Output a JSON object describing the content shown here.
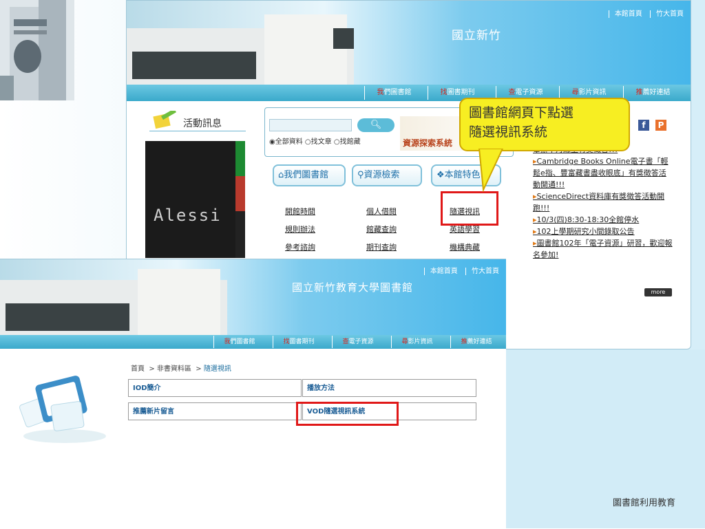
{
  "top_site": {
    "site_title": "國立新竹",
    "top_links": [
      "本館首頁",
      "竹大首頁"
    ],
    "nav": [
      {
        "accent": "我",
        "rest": "們圖書館"
      },
      {
        "accent": "找",
        "rest": "圖書期刊"
      },
      {
        "accent": "查",
        "rest": "電子資源"
      },
      {
        "accent": "尋",
        "rest": "影片資訊"
      },
      {
        "accent": "推",
        "rest": "薦好連結"
      }
    ],
    "activity_title": "活動訊息",
    "book_text": "Alessi",
    "search": {
      "button_icon": "search-icon",
      "radio_options": [
        "全部資料",
        "找文章",
        "找館藏"
      ],
      "selected": "全部資料",
      "resource_label": "資源探索系統"
    },
    "feature_buttons": [
      "我們圖書館",
      "資源檢索",
      "本館特色"
    ],
    "links": [
      [
        "開館時間",
        "個人借閱",
        "隨選視訊"
      ],
      [
        "規則辦法",
        "館藏查詢",
        "英語學習"
      ],
      [
        "參考諮詢",
        "期刊查詢",
        "機構典藏"
      ]
    ],
    "news": [
      "舉辦十月線上有獎徵答!!!",
      "Cambridge Books Online電子書「輕鬆e指、豐富藏書盡收眼底」有獎徵答活動開通!!!",
      "ScienceDirect資料庫有獎徵答活動開跑!!!",
      "10/3(四)8:30-18:30全館停水",
      "102上學期研究小間錄取公告",
      "圖書館102年「電子資源」研習，歡迎報名參加!"
    ],
    "more_label": "more"
  },
  "callout": {
    "line1": "圖書館網頁下點選",
    "line2": "隨選視訊系統"
  },
  "bottom_site": {
    "site_title": "國立新竹教育大學圖書館",
    "top_links": [
      "本館首頁",
      "竹大首頁"
    ],
    "breadcrumb": {
      "home": "首頁",
      "section": "非書資料區",
      "current": "隨選視訊"
    },
    "cells": [
      "IOD簡介",
      "播放方法",
      "推薦新片留言",
      "VOD隨選視訊系統"
    ]
  },
  "footer_text": "圖書館利用教育"
}
